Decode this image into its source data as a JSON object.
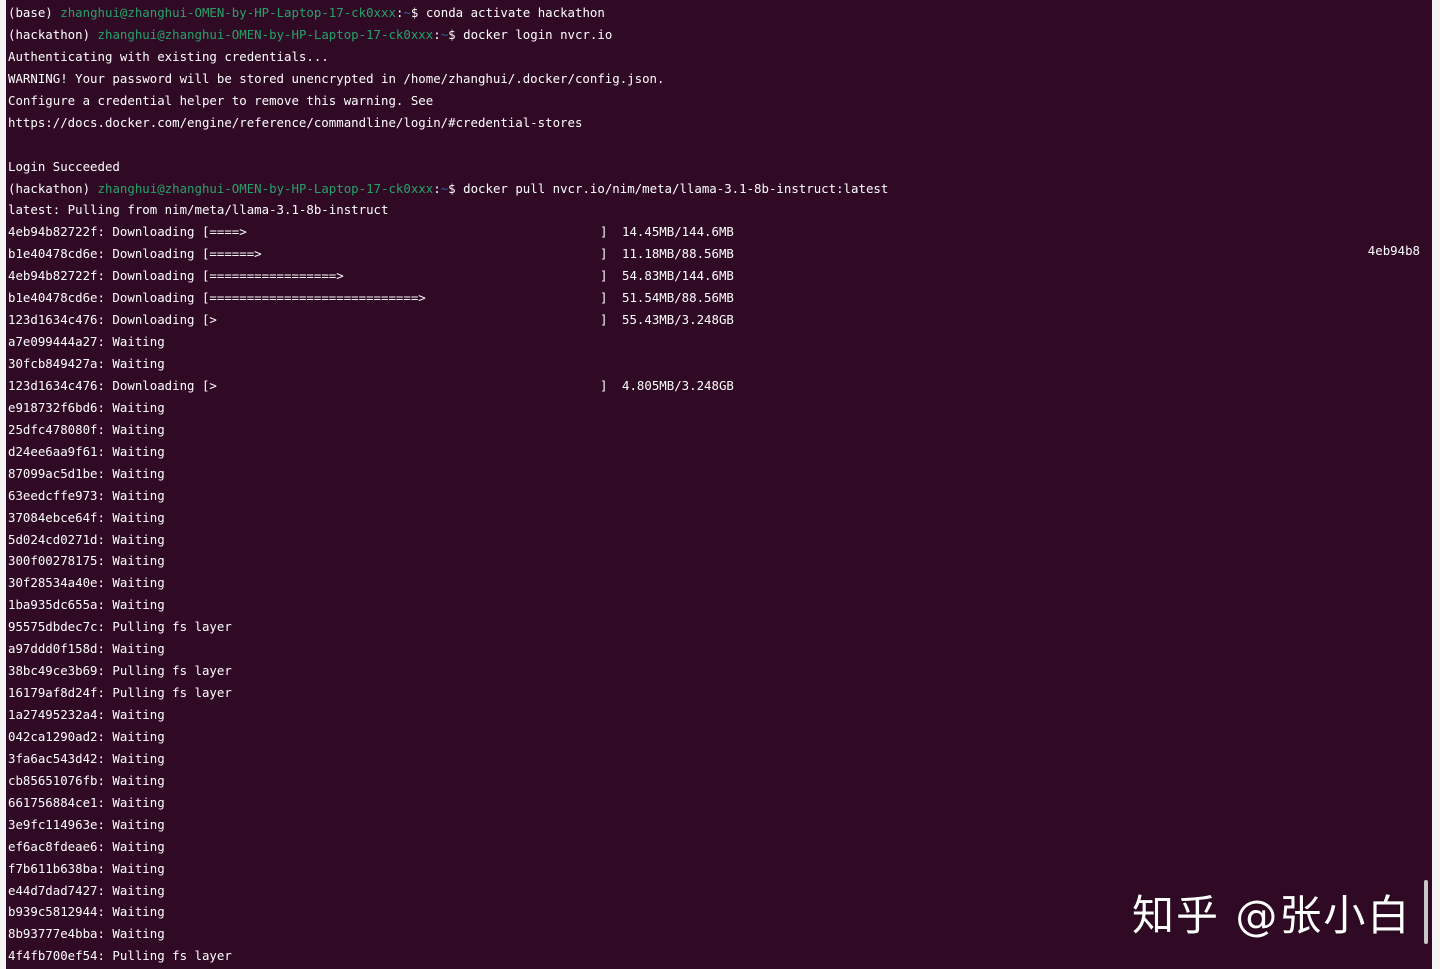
{
  "terminal": {
    "lines": [
      {
        "kind": "prompt",
        "env": "(base)",
        "user": "zhanghui@zhanghui-OMEN-by-HP-Laptop-17-ck0xxx",
        "path": "~",
        "sym": "$",
        "cmd": "conda activate hackathon"
      },
      {
        "kind": "prompt",
        "env": "(hackathon)",
        "user": "zhanghui@zhanghui-OMEN-by-HP-Laptop-17-ck0xxx",
        "path": "~",
        "sym": "$",
        "cmd": "docker login nvcr.io"
      },
      {
        "kind": "text",
        "text": "Authenticating with existing credentials..."
      },
      {
        "kind": "text",
        "text": "WARNING! Your password will be stored unencrypted in /home/zhanghui/.docker/config.json."
      },
      {
        "kind": "text",
        "text": "Configure a credential helper to remove this warning. See"
      },
      {
        "kind": "text",
        "text": "https://docs.docker.com/engine/reference/commandline/login/#credential-stores"
      },
      {
        "kind": "text",
        "text": ""
      },
      {
        "kind": "text",
        "text": "Login Succeeded"
      },
      {
        "kind": "prompt",
        "env": "(hackathon)",
        "user": "zhanghui@zhanghui-OMEN-by-HP-Laptop-17-ck0xxx",
        "path": "~",
        "sym": "$",
        "cmd": "docker pull nvcr.io/nim/meta/llama-3.1-8b-instruct:latest"
      },
      {
        "kind": "text",
        "text": "latest: Pulling from nim/meta/llama-3.1-8b-instruct"
      },
      {
        "kind": "progress",
        "prefix": "4eb94b82722f: Downloading [",
        "fill": "====>",
        "close": "]",
        "size": "14.45MB/144.6MB",
        "progress": 0.1
      },
      {
        "kind": "progress",
        "prefix": "b1e40478cd6e: Downloading [",
        "fill": "======>",
        "close": "]",
        "size": "11.18MB/88.56MB",
        "progress": 0.13
      },
      {
        "kind": "progress",
        "prefix": "4eb94b82722f: Downloading [",
        "fill": "=================>",
        "close": "]",
        "size": "54.83MB/144.6MB",
        "progress": 0.38
      },
      {
        "kind": "progress",
        "prefix": "b1e40478cd6e: Downloading [",
        "fill": "============================>",
        "close": "]",
        "size": "51.54MB/88.56MB",
        "progress": 0.58
      },
      {
        "kind": "progress",
        "prefix": "123d1634c476: Downloading [",
        "fill": ">",
        "close": "]",
        "size": "55.43MB/3.248GB",
        "progress": 0.02
      },
      {
        "kind": "text",
        "text": "a7e099444a27: Waiting"
      },
      {
        "kind": "text",
        "text": "30fcb849427a: Waiting"
      },
      {
        "kind": "progress",
        "prefix": "123d1634c476: Downloading [",
        "fill": ">",
        "close": "]",
        "size": "4.805MB/3.248GB",
        "progress": 0.0
      },
      {
        "kind": "text",
        "text": "e918732f6bd6: Waiting"
      },
      {
        "kind": "text",
        "text": "25dfc478080f: Waiting"
      },
      {
        "kind": "text",
        "text": "d24ee6aa9f61: Waiting"
      },
      {
        "kind": "text",
        "text": "87099ac5d1be: Waiting"
      },
      {
        "kind": "text",
        "text": "63eedcffe973: Waiting"
      },
      {
        "kind": "text",
        "text": "37084ebce64f: Waiting"
      },
      {
        "kind": "text",
        "text": "5d024cd0271d: Waiting"
      },
      {
        "kind": "text",
        "text": "300f00278175: Waiting"
      },
      {
        "kind": "text",
        "text": "30f28534a40e: Waiting"
      },
      {
        "kind": "text",
        "text": "1ba935dc655a: Waiting"
      },
      {
        "kind": "text",
        "text": "95575dbdec7c: Pulling fs layer"
      },
      {
        "kind": "text",
        "text": "a97ddd0f158d: Waiting"
      },
      {
        "kind": "text",
        "text": "38bc49ce3b69: Pulling fs layer"
      },
      {
        "kind": "text",
        "text": "16179af8d24f: Pulling fs layer"
      },
      {
        "kind": "text",
        "text": "1a27495232a4: Waiting"
      },
      {
        "kind": "text",
        "text": "042ca1290ad2: Waiting"
      },
      {
        "kind": "text",
        "text": "3fa6ac543d42: Waiting"
      },
      {
        "kind": "text",
        "text": "cb85651076fb: Waiting"
      },
      {
        "kind": "text",
        "text": "661756884ce1: Waiting"
      },
      {
        "kind": "text",
        "text": "3e9fc114963e: Waiting"
      },
      {
        "kind": "text",
        "text": "ef6ac8fdeae6: Waiting"
      },
      {
        "kind": "text",
        "text": "f7b611b638ba: Waiting"
      },
      {
        "kind": "text",
        "text": "e44d7dad7427: Waiting"
      },
      {
        "kind": "text",
        "text": "b939c5812944: Waiting"
      },
      {
        "kind": "text",
        "text": "8b93777e4bba: Waiting"
      },
      {
        "kind": "text",
        "text": "4f4fb700ef54: Pulling fs layer"
      }
    ],
    "side_id": "4eb94b8",
    "colors": {
      "background": "#300a24",
      "text": "#ffffff",
      "user": "#26a269",
      "path": "#3465a4"
    }
  },
  "watermark": {
    "text": "知乎 @张小白"
  }
}
